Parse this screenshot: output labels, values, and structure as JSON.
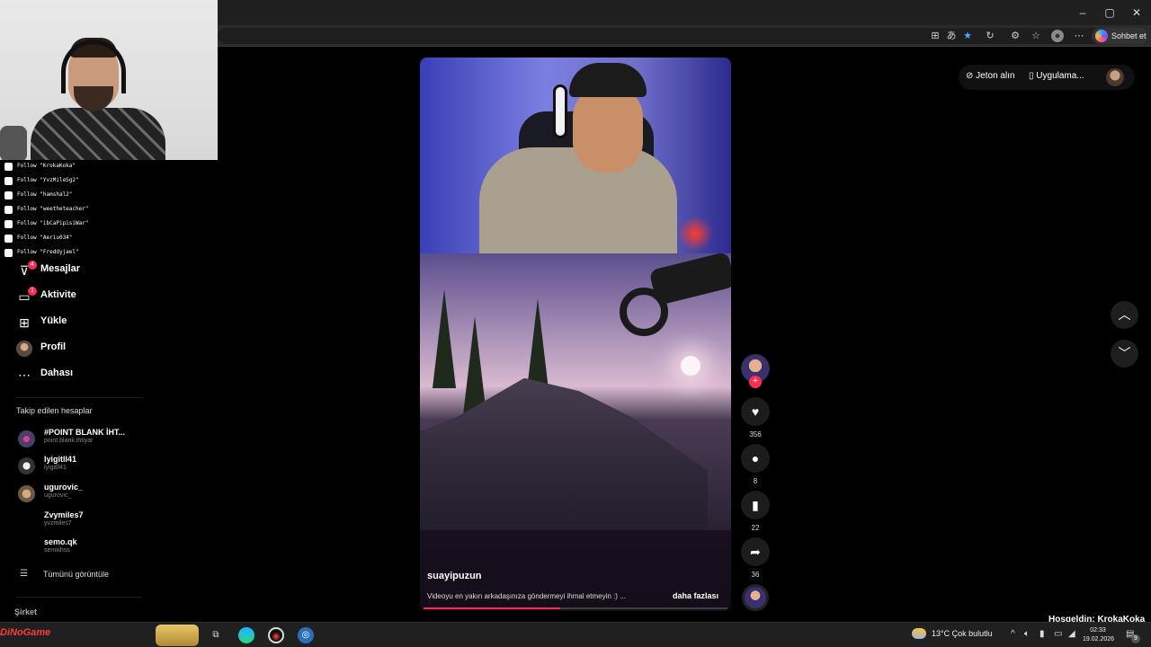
{
  "window": {
    "controls": {
      "minimize": "–",
      "maximize": "▢",
      "close": "✕"
    }
  },
  "browser": {
    "copilot_label": "Sohbet et",
    "toolbar_icons": [
      "app-icon",
      "translate-icon",
      "star-icon",
      "refresh-icon",
      "extensions-icon",
      "favorites-icon",
      "profile-icon",
      "more-icon"
    ]
  },
  "overlay": {
    "follows": [
      "Follow \"KrokaKoka\"",
      "Follow \"YvzMileSg2\"",
      "Follow \"hamshal2\"",
      "Follow \"weetheteacher\"",
      "Follow \"ibCaPipisiWar\"",
      "Follow \"Aeriu034\"",
      "Follow \"Freddyjael\""
    ]
  },
  "sidebar": {
    "nav": [
      {
        "label": "Mesajlar",
        "icon": "send-icon",
        "badge": "4"
      },
      {
        "label": "Aktivite",
        "icon": "activity-icon",
        "badge": "1"
      },
      {
        "label": "Yükle",
        "icon": "upload-icon",
        "badge": ""
      },
      {
        "label": "Profil",
        "icon": "profile-avatar",
        "badge": ""
      },
      {
        "label": "Dahası",
        "icon": "more-icon",
        "badge": ""
      }
    ],
    "following_title": "Takip edilen hesaplar",
    "accounts": [
      {
        "name": "#POINT BLANK İHT...",
        "handle": "point.blank.ihtiyar"
      },
      {
        "name": "Iyigitll41",
        "handle": "iyigitll41"
      },
      {
        "name": "ugurovic_",
        "handle": "ugurovic_"
      },
      {
        "name": "Zvymiles7",
        "handle": "yvzmiles7"
      },
      {
        "name": "semo.qk",
        "handle": "semiiihss"
      }
    ],
    "see_all": "Tümünü görüntüle",
    "company": "Şirket"
  },
  "header": {
    "coins": "Jeton alın",
    "app": "Uygulama..."
  },
  "video": {
    "author": "suayipuzun",
    "description": "Videoyu en yakın arkadaşınıza göndermeyi ihmal etmeyin :) ...",
    "more": "daha fazlası",
    "progress": 0.45
  },
  "actions": {
    "likes": "356",
    "comments": "8",
    "saves": "22",
    "shares": "36"
  },
  "taskbar": {
    "logo": "DiNoGame",
    "weather": "13°C  Çok bulutlu",
    "time": "02:33",
    "date": "19.02.2026",
    "notifications": "9"
  },
  "stream": {
    "welcome": "Hoşgeldin: KrokaKoka"
  },
  "colors": {
    "accent": "#fe2c55",
    "background": "#000000"
  }
}
